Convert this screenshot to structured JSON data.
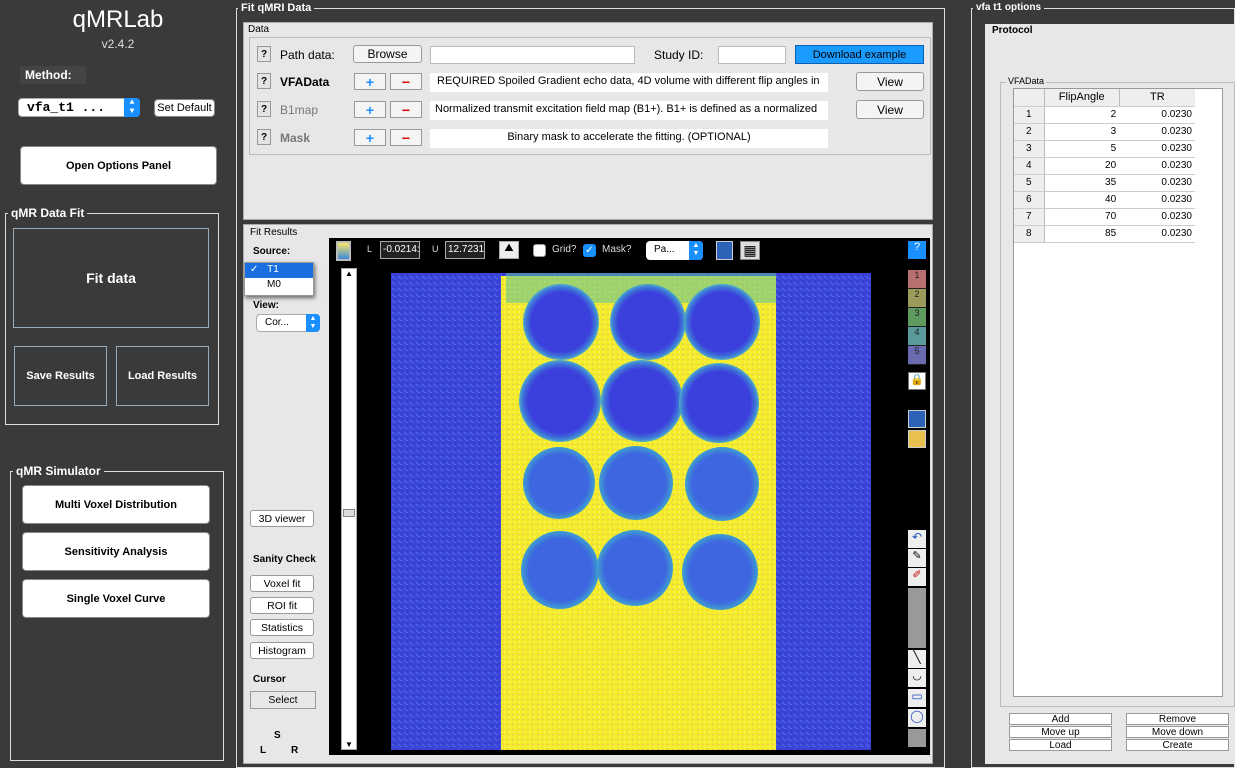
{
  "app": {
    "title": "qMRLab",
    "version": "v2.4.2"
  },
  "left": {
    "method_label": "Method:",
    "method_value": "vfa_t1 ...",
    "set_default": "Set Default",
    "open_options": "Open Options Panel",
    "data_fit_title": "qMR Data Fit",
    "fit_data": "Fit data",
    "save_results": "Save Results",
    "load_results": "Load Results",
    "simulator_title": "qMR Simulator",
    "sim_buttons": [
      "Multi Voxel Distribution",
      "Sensitivity Analysis",
      "Single Voxel Curve"
    ]
  },
  "fit_panel": {
    "title": "Fit qMRI Data",
    "data_title": "Data",
    "path_label": "Path data:",
    "browse": "Browse",
    "study_label": "Study ID:",
    "download": "Download example",
    "rows": [
      {
        "name": "VFAData",
        "desc": "REQUIRED Spoiled Gradient echo data, 4D volume with different flip angles in",
        "view": "View"
      },
      {
        "name": "B1map",
        "desc": "Normalized transmit excitation field map (B1+). B1+ is defined as a  normalized",
        "view": "View"
      },
      {
        "name": "Mask",
        "desc": "Binary mask to accelerate the fitting. (OPTIONAL)",
        "view": ""
      }
    ],
    "results_title": "Fit Results",
    "source_label": "Source:",
    "source_options": [
      "T1",
      "M0"
    ],
    "view_label": "View:",
    "view_value": "Cor...",
    "viewer3d": "3D viewer",
    "sanity_label": "Sanity Check",
    "sanity_buttons": [
      "Voxel fit",
      "ROI fit",
      "Statistics",
      "Histogram"
    ],
    "cursor_label": "Cursor",
    "select": "Select",
    "orient": [
      "S",
      "L",
      "R"
    ],
    "toolbar": {
      "l_label": "L",
      "l_value": "-0.0214:",
      "u_label": "U",
      "u_value": "12.7231",
      "grid": "Grid?",
      "mask": "Mask?",
      "pan": "Pa...",
      "help": "?"
    },
    "colorbar": [
      "1",
      "2",
      "3",
      "4",
      "5"
    ]
  },
  "options": {
    "title": "vfa t1 options",
    "protocol": "Protocol",
    "table_title": "VFAData",
    "headers": [
      "FlipAngle",
      "TR"
    ],
    "rows": [
      [
        "1",
        "2",
        "0.0230"
      ],
      [
        "2",
        "3",
        "0.0230"
      ],
      [
        "3",
        "5",
        "0.0230"
      ],
      [
        "4",
        "20",
        "0.0230"
      ],
      [
        "5",
        "35",
        "0.0230"
      ],
      [
        "6",
        "40",
        "0.0230"
      ],
      [
        "7",
        "70",
        "0.0230"
      ],
      [
        "8",
        "85",
        "0.0230"
      ]
    ],
    "buttons": [
      "Add",
      "Remove",
      "Move up",
      "Move down",
      "Load",
      "Create"
    ]
  },
  "colors": {
    "accent": "#1a8fff",
    "bg": "#3a3a3a",
    "mri_blue": "#3a44d8",
    "mri_yellow": "#f2f032"
  }
}
